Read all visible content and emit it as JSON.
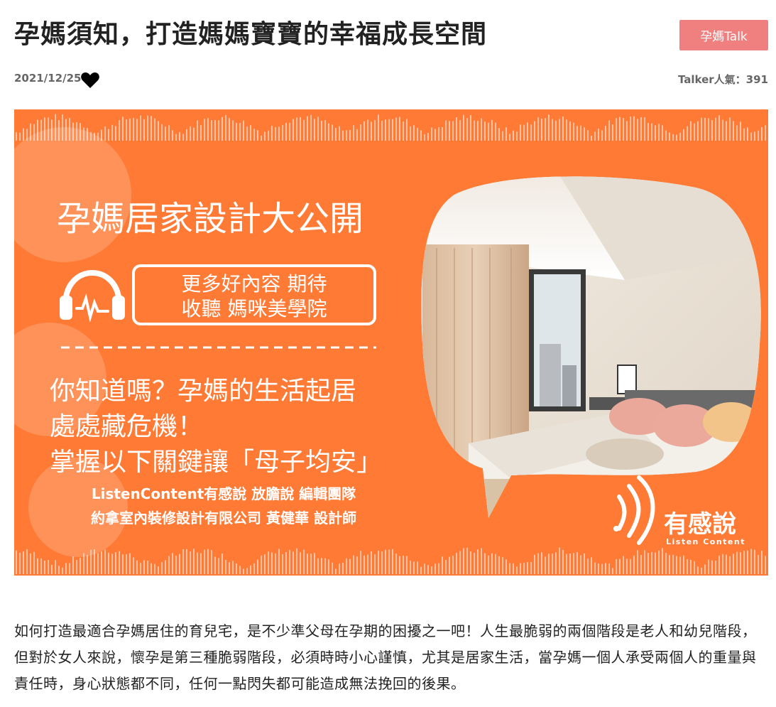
{
  "article": {
    "title": "孕媽須知，打造媽媽寶寶的幸福成長空間",
    "tag_label": "孕媽Talk",
    "date": "2021/12/25",
    "popularity": "Talker人氣：391",
    "body": "如何打造最適合孕媽居住的育兒宅，是不少準父母在孕期的困擾之一吧！人生最脆弱的兩個階段是老人和幼兒階段，但對於女人來說，懷孕是第三種脆弱階段，必須時時小心謹慎，尤其是居家生活，當孕媽一個人承受兩個人的重量與責任時，身心狀態都不同，任何一點閃失都可能造成無法挽回的後果。"
  },
  "banner": {
    "headline": "孕媽居家設計大公開",
    "box_line1": "更多好內容 期待",
    "box_line2": "收聽 媽咪美學院",
    "question_line1": "你知道嗎？孕媽的生活起居",
    "question_line2": "處處藏危機！",
    "question_line3": "掌握以下關鍵讓「母子均安」",
    "credit_line1": "ListenContent有感說 放膽說 編輯團隊",
    "credit_line2": "約拿室內裝修設計有限公司 黃健華 設計師",
    "logo_text": "有感說",
    "logo_sub": "Listen Content"
  },
  "colors": {
    "banner_orange": "#ff7a35",
    "tag_pink": "#f08080",
    "text_dark": "#222222",
    "meta_gray": "#666666"
  },
  "icons": [
    "heart-icon",
    "headphones-icon",
    "listen-content-logo-icon"
  ]
}
